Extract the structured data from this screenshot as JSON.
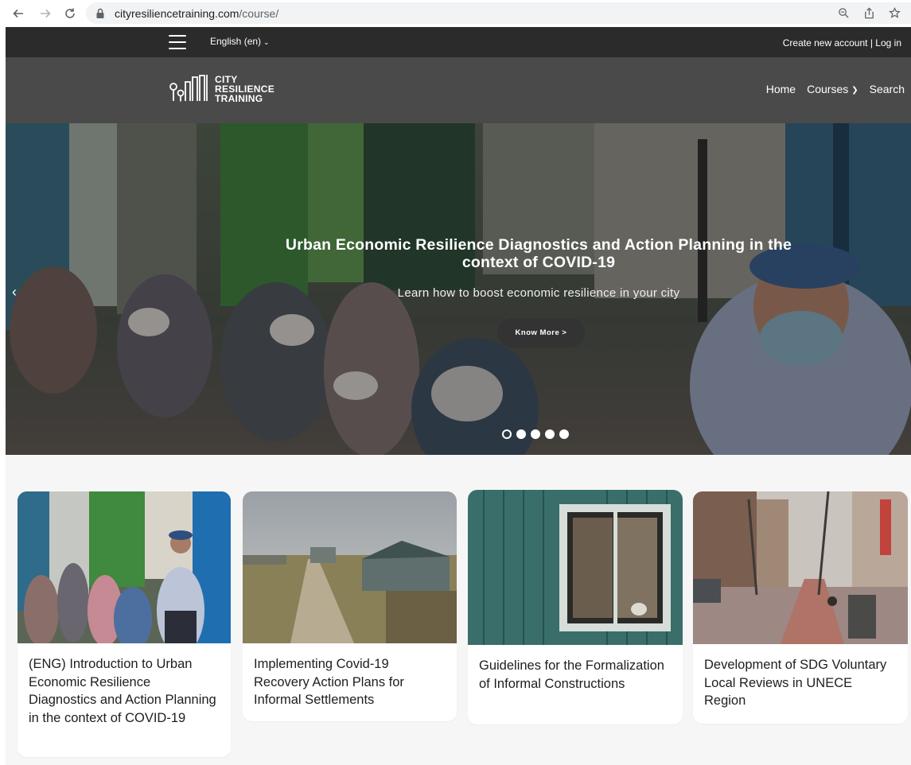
{
  "browser": {
    "url_host": "cityresiliencetraining.com",
    "url_path": "/course/"
  },
  "topbar": {
    "language": "English (en)",
    "create_account": "Create new account",
    "separator": "|",
    "login": "Log in"
  },
  "logo": {
    "line1": "CITY",
    "line2": "RESILIENCE",
    "line3": "TRAINING"
  },
  "nav": {
    "home": "Home",
    "courses": "Courses",
    "search": "Search"
  },
  "hero": {
    "title": "Urban Economic Resilience Diagnostics and Action Planning in the context of COVID-19",
    "subtitle": "Learn how to boost economic resilience in your city",
    "button": "Know More >",
    "slide_count": 5,
    "active_slide": 1
  },
  "courses": [
    {
      "title": "(ENG) Introduction to Urban Economic Resilience Diagnostics and Action Planning in the context of COVID-19"
    },
    {
      "title": "Implementing Covid-19 Recovery Action Plans for Informal Settlements"
    },
    {
      "title": "Guidelines for the Formalization of Informal Constructions"
    },
    {
      "title": "Development of SDG Voluntary Local Reviews in UNECE Region"
    }
  ],
  "colors": {
    "topbar_bg": "#2b2b2b",
    "nav_bg": "#4a4a4a",
    "button_bg": "#333333",
    "page_bg": "#f6f6f6"
  }
}
